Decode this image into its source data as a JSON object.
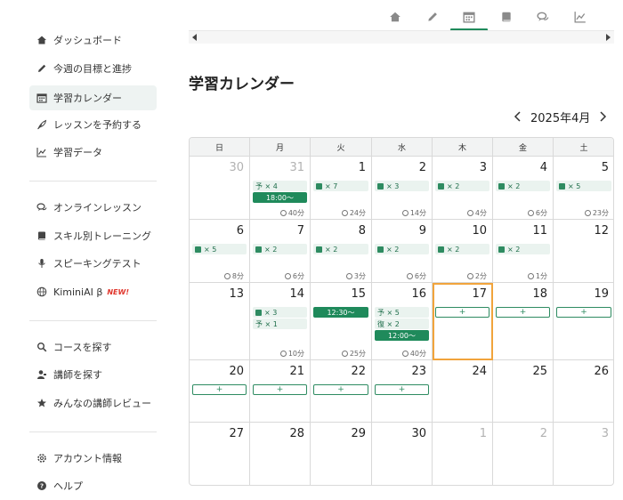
{
  "sidebar": {
    "items": [
      {
        "label": "ダッシュボード",
        "icon": "home-icon"
      },
      {
        "label": "今週の目標と進捗",
        "icon": "pencil-icon"
      },
      {
        "label": "学習カレンダー",
        "icon": "calendar-icon",
        "active": true
      },
      {
        "label": "レッスンを予約する",
        "icon": "feather-icon"
      },
      {
        "label": "学習データ",
        "icon": "chart-icon"
      },
      {
        "label": "オンラインレッスン",
        "icon": "chat-icon"
      },
      {
        "label": "スキル別トレーニング",
        "icon": "book-icon"
      },
      {
        "label": "スピーキングテスト",
        "icon": "mic-icon"
      },
      {
        "label": "KiminiAI β",
        "icon": "globe-icon",
        "badge": "NEW!"
      },
      {
        "label": "コースを探す",
        "icon": "search-icon"
      },
      {
        "label": "講師を探す",
        "icon": "teacher-icon"
      },
      {
        "label": "みんなの講師レビュー",
        "icon": "star-icon"
      },
      {
        "label": "アカウント情報",
        "icon": "gear-icon"
      },
      {
        "label": "ヘルプ",
        "icon": "help-icon"
      }
    ]
  },
  "tabs": [
    "home-icon",
    "pencil-icon",
    "calendar-icon",
    "book-icon",
    "chat-icon",
    "chart-icon"
  ],
  "page_title": "学習カレンダー",
  "calendar": {
    "month_label": "2025年4月",
    "weekdays": [
      "日",
      "月",
      "火",
      "水",
      "木",
      "金",
      "土"
    ],
    "add_label": "+",
    "weeks": [
      [
        {
          "day": "30",
          "muted": true
        },
        {
          "day": "31",
          "muted": true,
          "chips": [
            "予 × 4"
          ],
          "events": [
            "18:00～"
          ],
          "dur": "40分"
        },
        {
          "day": "1",
          "chips": [
            "× 7"
          ],
          "books": [
            true
          ],
          "dur": "24分"
        },
        {
          "day": "2",
          "chips": [
            "× 3"
          ],
          "books": [
            true
          ],
          "dur": "14分"
        },
        {
          "day": "3",
          "chips": [
            "× 2"
          ],
          "books": [
            true
          ],
          "dur": "4分"
        },
        {
          "day": "4",
          "chips": [
            "× 2"
          ],
          "books": [
            true
          ],
          "dur": "6分"
        },
        {
          "day": "5",
          "chips": [
            "× 5"
          ],
          "books": [
            true
          ],
          "dur": "23分"
        }
      ],
      [
        {
          "day": "6",
          "chips": [
            "× 5"
          ],
          "books": [
            true
          ],
          "dur": "8分"
        },
        {
          "day": "7",
          "chips": [
            "× 2"
          ],
          "books": [
            true
          ],
          "dur": "6分"
        },
        {
          "day": "8",
          "chips": [
            "× 2"
          ],
          "books": [
            true
          ],
          "dur": "3分"
        },
        {
          "day": "9",
          "chips": [
            "× 2"
          ],
          "books": [
            true
          ],
          "dur": "6分"
        },
        {
          "day": "10",
          "chips": [
            "× 2"
          ],
          "books": [
            true
          ],
          "dur": "2分"
        },
        {
          "day": "11",
          "chips": [
            "× 2"
          ],
          "books": [
            true
          ],
          "dur": "1分"
        },
        {
          "day": "12"
        }
      ],
      [
        {
          "day": "13"
        },
        {
          "day": "14",
          "chips": [
            "× 3",
            "予 × 1"
          ],
          "books": [
            true,
            false
          ],
          "dur": "10分"
        },
        {
          "day": "15",
          "events": [
            "12:30～"
          ],
          "dur": "25分"
        },
        {
          "day": "16",
          "chips": [
            "予 × 5",
            "復 × 2"
          ],
          "books": [
            false,
            false
          ],
          "events": [
            "12:00～"
          ],
          "dur": "40分"
        },
        {
          "day": "17",
          "today": true,
          "add": true
        },
        {
          "day": "18",
          "add": true
        },
        {
          "day": "19",
          "add": true
        }
      ],
      [
        {
          "day": "20",
          "add": true
        },
        {
          "day": "21",
          "add": true
        },
        {
          "day": "22",
          "add": true
        },
        {
          "day": "23",
          "add": true
        },
        {
          "day": "24"
        },
        {
          "day": "25"
        },
        {
          "day": "26"
        }
      ],
      [
        {
          "day": "27"
        },
        {
          "day": "28"
        },
        {
          "day": "29"
        },
        {
          "day": "30"
        },
        {
          "day": "1",
          "muted": true
        },
        {
          "day": "2",
          "muted": true
        },
        {
          "day": "3",
          "muted": true
        }
      ]
    ]
  },
  "colors": {
    "accent": "#1f8a5b",
    "today_border": "#f1a43c",
    "chip_bg": "#eaf3ef"
  }
}
